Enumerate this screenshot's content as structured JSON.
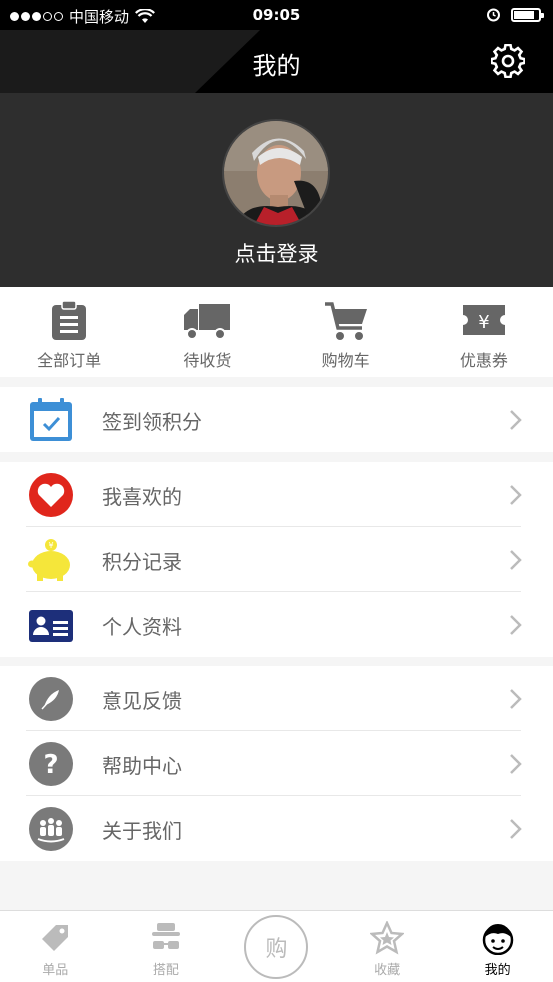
{
  "status_bar": {
    "carrier": "中国移动",
    "time": "09:05"
  },
  "nav": {
    "title": "我的"
  },
  "profile": {
    "login_text": "点击登录"
  },
  "orders": [
    {
      "label": "全部订单",
      "icon": "clipboard-icon"
    },
    {
      "label": "待收货",
      "icon": "truck-icon"
    },
    {
      "label": "购物车",
      "icon": "cart-icon"
    },
    {
      "label": "优惠券",
      "icon": "coupon-icon"
    }
  ],
  "group1": [
    {
      "label": "签到领积分",
      "icon": "calendar-icon"
    }
  ],
  "group2": [
    {
      "label": "我喜欢的",
      "icon": "heart-icon"
    },
    {
      "label": "积分记录",
      "icon": "piggy-bank-icon"
    },
    {
      "label": "个人资料",
      "icon": "id-card-icon"
    }
  ],
  "group3": [
    {
      "label": "意见反馈",
      "icon": "feather-icon"
    },
    {
      "label": "帮助中心",
      "icon": "question-icon"
    },
    {
      "label": "关于我们",
      "icon": "group-icon"
    }
  ],
  "tabs": [
    {
      "label": "单品",
      "icon": "tag-icon"
    },
    {
      "label": "搭配",
      "icon": "hat-glasses-icon"
    },
    {
      "label": "购",
      "icon": "buy-circle"
    },
    {
      "label": "收藏",
      "icon": "star-icon"
    },
    {
      "label": "我的",
      "icon": "face-icon"
    }
  ],
  "colors": {
    "accent_blue": "#3d8fd6",
    "heart_red": "#e0261c",
    "piggy_yellow": "#f5e63a",
    "card_navy": "#1d2f7a",
    "gray_icon": "#7a7a7a"
  }
}
